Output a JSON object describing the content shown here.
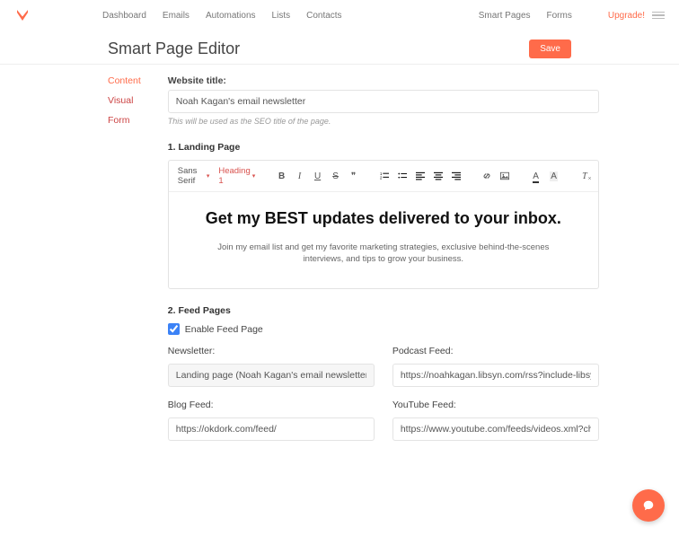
{
  "nav": {
    "items": [
      "Dashboard",
      "Emails",
      "Automations",
      "Lists",
      "Contacts"
    ],
    "right_items": [
      "Smart Pages",
      "Forms"
    ],
    "upgrade": "Upgrade!"
  },
  "page": {
    "title": "Smart Page Editor",
    "save_label": "Save"
  },
  "tabs": {
    "content": "Content",
    "visual": "Visual",
    "form": "Form"
  },
  "website_title": {
    "label": "Website title:",
    "value": "Noah Kagan's email newsletter",
    "hint": "This will be used as the SEO title of the page."
  },
  "section1_title": "1. Landing Page",
  "toolbar": {
    "font_family": "Sans Serif",
    "heading": "Heading 1"
  },
  "editor": {
    "heading": "Get my BEST updates delivered to your inbox.",
    "paragraph": "Join my email list and get my favorite marketing strategies, exclusive behind-the-scenes interviews, and tips to grow your business."
  },
  "section2_title": "2. Feed Pages",
  "feed": {
    "enable_label": "Enable Feed Page",
    "enabled": true,
    "newsletter_label": "Newsletter:",
    "newsletter_value": "Landing page (Noah Kagan's email newsletter)",
    "podcast_label": "Podcast Feed:",
    "podcast_value": "https://noahkagan.libsyn.com/rss?include-libsyn",
    "blog_label": "Blog Feed:",
    "blog_value": "https://okdork.com/feed/",
    "youtube_label": "YouTube Feed:",
    "youtube_value": "https://www.youtube.com/feeds/videos.xml?cha"
  }
}
